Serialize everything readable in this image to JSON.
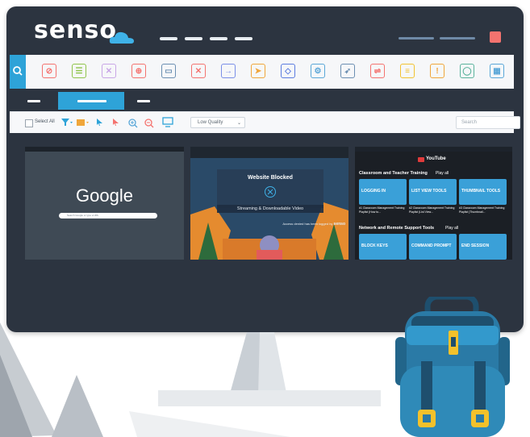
{
  "app": {
    "logo_text": "senso",
    "logo_dot": "."
  },
  "colors": {
    "brand_blue": "#2ea3d8",
    "frame": "#2c3440",
    "close_red": "#f4736f"
  },
  "toolbar": {
    "search_icon": "search-icon",
    "tools": [
      {
        "name": "block-icon",
        "glyph": "⊘",
        "color": "#f4736f"
      },
      {
        "name": "checklist-icon",
        "glyph": "☰",
        "color": "#8fc54b"
      },
      {
        "name": "mute-icon",
        "glyph": "✕",
        "color": "#c9a6e6"
      },
      {
        "name": "globe-icon",
        "glyph": "⊕",
        "color": "#f4736f"
      },
      {
        "name": "screen-share-icon",
        "glyph": "▭",
        "color": "#6b8fb2"
      },
      {
        "name": "close-window-icon",
        "glyph": "✕",
        "color": "#f4736f"
      },
      {
        "name": "login-icon",
        "glyph": "→",
        "color": "#7a8fe8"
      },
      {
        "name": "send-message-icon",
        "glyph": "➤",
        "color": "#f0a63a"
      },
      {
        "name": "code-file-icon",
        "glyph": "◇",
        "color": "#5b7ce0"
      },
      {
        "name": "settings-icon",
        "glyph": "⚙",
        "color": "#5aa7d8"
      },
      {
        "name": "rocket-icon",
        "glyph": "➶",
        "color": "#6b8fb2"
      },
      {
        "name": "usb-icon",
        "glyph": "⇌",
        "color": "#f4736f"
      },
      {
        "name": "document-icon",
        "glyph": "≡",
        "color": "#f2c230"
      },
      {
        "name": "warning-icon",
        "glyph": "!",
        "color": "#f0a63a"
      },
      {
        "name": "shield-icon",
        "glyph": "◯",
        "color": "#5ab39c"
      },
      {
        "name": "scan-icon",
        "glyph": "▦",
        "color": "#5aa7d8"
      }
    ]
  },
  "actionbar": {
    "select_all": "Select All",
    "quality": "Low Quality",
    "search_placeholder": "Search"
  },
  "thumbnails": {
    "google": {
      "logo": "Google",
      "search_hint": "Search Google or type a URL"
    },
    "blocked": {
      "title": "Website Blocked",
      "reason": "Streaming & Downloadable Video",
      "footer": "Access denied has been logged by",
      "footer_brand": "senso"
    },
    "youtube": {
      "brand": "YouTube",
      "sections": [
        {
          "title": "Classroom and Teacher Training",
          "play_all": "Play all",
          "videos": [
            {
              "thumb_text": "LOGGING IN",
              "caption": "#1 Classroom Management Training Playlist (How to..."
            },
            {
              "thumb_text": "LIST VIEW TOOLS",
              "caption": "#2 Classroom Management Training Playlist (List View..."
            },
            {
              "thumb_text": "THUMBNAIL TOOLS",
              "caption": "#3 Classroom Management Training Playlist (Thumbnail..."
            }
          ]
        },
        {
          "title": "Network and Remote Support Tools",
          "play_all": "Play all",
          "videos": [
            {
              "thumb_text": "BLOCK KEYS",
              "caption": ""
            },
            {
              "thumb_text": "COMMAND PROMPT",
              "caption": ""
            },
            {
              "thumb_text": "END SESSION",
              "caption": ""
            }
          ]
        }
      ]
    }
  }
}
